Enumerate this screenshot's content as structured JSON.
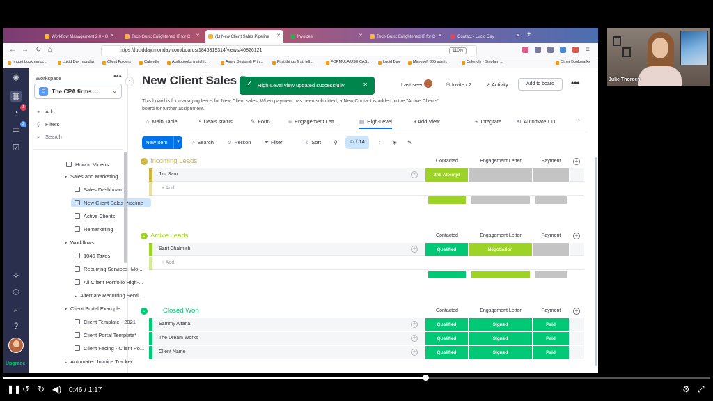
{
  "browser": {
    "tabs": [
      {
        "label": "Workflow Management 2.0 - G"
      },
      {
        "label": "Tech Guru: Enlightened IT for C"
      },
      {
        "label": "(1) New Client Sales Pipeline"
      },
      {
        "label": "Invoices"
      },
      {
        "label": "Tech Guru: Enlightened IT for C"
      },
      {
        "label": "Contact - Lucid Day"
      }
    ],
    "url": "https://lucidday.monday.com/boards/1846319314/views/40826121",
    "zoom": "110%",
    "bookmarks": [
      "Import bookmarks...",
      "Lucid Day monday",
      "Client Folders",
      "Calendly",
      "Audiobooks matchi...",
      "Avery Design & Prin...",
      "First things first, tell...",
      "FORMULA USE CAS...",
      "Lucid Day",
      "Microsoft 365 admi...",
      "Calendly - Stephen ...",
      "Other Bookmarks"
    ]
  },
  "rail": {
    "notif_badge": "1",
    "inbox_badge": "2",
    "upgrade_label": "Upgrade"
  },
  "sidebar": {
    "workspace_label": "Workspace",
    "workspace_name": "The CPA firms ...",
    "actions": {
      "add": "Add",
      "filters": "Filters",
      "search": "Search"
    },
    "tree": [
      {
        "label": "How to Videos",
        "kind": "board"
      },
      {
        "label": "Sales and Marketing",
        "kind": "folder"
      },
      {
        "label": "Sales Dashboard",
        "kind": "board"
      },
      {
        "label": "New Client Sales Pipeline",
        "kind": "board"
      },
      {
        "label": "Active Clients",
        "kind": "board"
      },
      {
        "label": "Remarketing",
        "kind": "board"
      },
      {
        "label": "Workflows",
        "kind": "folder"
      },
      {
        "label": "1040 Taxes",
        "kind": "board"
      },
      {
        "label": "Recurring Services- Mo...",
        "kind": "board"
      },
      {
        "label": "All Client Portfolio High-...",
        "kind": "board"
      },
      {
        "label": "Alternate Recurring Servi...",
        "kind": "collapsed"
      },
      {
        "label": "Client Portal Example",
        "kind": "folder"
      },
      {
        "label": "Client Template - 2021",
        "kind": "board"
      },
      {
        "label": "Client Portal Template*",
        "kind": "board"
      },
      {
        "label": "Client Facing - Client Po...",
        "kind": "board"
      },
      {
        "label": "Automated Invoice Tracker",
        "kind": "collapsed"
      }
    ]
  },
  "board": {
    "title": "New Client Sales P",
    "toast": "High-Level view updated successfully",
    "last_seen": "Last seen",
    "invite": "Invite / 2",
    "activity": "Activity",
    "add_to_board": "Add to board",
    "description": "This board is for managing leads for New Client sales. When payment has been submitted, a New Contact is added to the \"Active Clients\" board for further assignment.",
    "views": [
      "Main Table",
      "Deals status",
      "Form",
      "Engagement Lett...",
      "High-Level",
      "+ Add View"
    ],
    "integrate": "Integrate",
    "automate": "Automate / 11",
    "toolbar": {
      "new_item": "New Item",
      "search": "Search",
      "person": "Person",
      "filter": "Filter",
      "sort": "Sort",
      "hidden": "/ 14"
    },
    "columns": [
      "Contacted",
      "Engagement Letter",
      "Payment"
    ],
    "add_row": "+ Add",
    "groups": [
      {
        "title": "Incoming Leads",
        "color": "#cab641",
        "rows": [
          {
            "name": "Jim Sam",
            "cells": [
              "2nd Attempt",
              "",
              ""
            ]
          }
        ]
      },
      {
        "title": "Active Leads",
        "color": "#9cd326",
        "rows": [
          {
            "name": "Sarit Chalmish",
            "cells": [
              "Qualified",
              "Negotiation",
              ""
            ]
          }
        ]
      },
      {
        "title": "Closed Won",
        "color": "#00c875",
        "rows": [
          {
            "name": "Sammy Altana",
            "cells": [
              "Qualified",
              "Signed",
              "Paid"
            ]
          },
          {
            "name": "The Dream Works",
            "cells": [
              "Qualified",
              "Signed",
              "Paid"
            ]
          },
          {
            "name": "Client Name",
            "cells": [
              "Qualified",
              "Signed",
              "Paid"
            ]
          }
        ]
      }
    ]
  },
  "webcam": {
    "name": "Julie Thoreen"
  },
  "player": {
    "current": "0:46",
    "separator": "/",
    "duration": "1:17",
    "progress": 0.597
  }
}
